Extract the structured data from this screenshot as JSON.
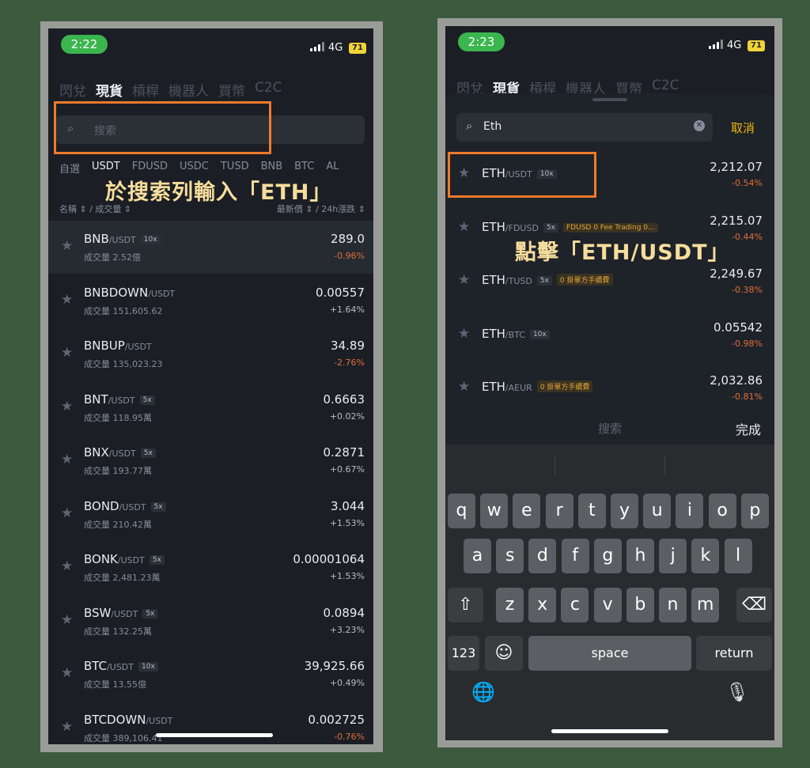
{
  "left": {
    "status": {
      "time": "2:22",
      "network": "4G",
      "battery": "71"
    },
    "top_tabs": [
      "閃兌",
      "現貨",
      "槓桿",
      "機器人",
      "買幣",
      "C2C"
    ],
    "active_tab_index": 1,
    "search_placeholder": "搜索",
    "sub_tabs": [
      "自選",
      "USDT",
      "FDUSD",
      "USDC",
      "TUSD",
      "BNB",
      "BTC",
      "AL"
    ],
    "active_sub_tab_index": 1,
    "annotation": "於搜索列輸入「ETH」",
    "header": {
      "left": "名稱 ⇕ / 成交量 ⇕",
      "right": "最新價 ⇕ / 24h漲跌 ⇕"
    },
    "rows": [
      {
        "base": "BNB",
        "quote": "/USDT",
        "lev": "10x",
        "vol": "成交量 2.52億",
        "price": "289.0",
        "chg": "-0.96%",
        "dir": "neg"
      },
      {
        "base": "BNBDOWN",
        "quote": "/USDT",
        "lev": "",
        "vol": "成交量 151,605.62",
        "price": "0.00557",
        "chg": "+1.64%",
        "dir": "pos"
      },
      {
        "base": "BNBUP",
        "quote": "/USDT",
        "lev": "",
        "vol": "成交量 135,023.23",
        "price": "34.89",
        "chg": "-2.76%",
        "dir": "neg"
      },
      {
        "base": "BNT",
        "quote": "/USDT",
        "lev": "5x",
        "vol": "成交量 118.95萬",
        "price": "0.6663",
        "chg": "+0.02%",
        "dir": "pos"
      },
      {
        "base": "BNX",
        "quote": "/USDT",
        "lev": "5x",
        "vol": "成交量 193.77萬",
        "price": "0.2871",
        "chg": "+0.67%",
        "dir": "pos"
      },
      {
        "base": "BOND",
        "quote": "/USDT",
        "lev": "5x",
        "vol": "成交量 210.42萬",
        "price": "3.044",
        "chg": "+1.53%",
        "dir": "pos"
      },
      {
        "base": "BONK",
        "quote": "/USDT",
        "lev": "5x",
        "vol": "成交量 2,481.23萬",
        "price": "0.00001064",
        "chg": "+1.53%",
        "dir": "pos"
      },
      {
        "base": "BSW",
        "quote": "/USDT",
        "lev": "5x",
        "vol": "成交量 132.25萬",
        "price": "0.0894",
        "chg": "+3.23%",
        "dir": "pos"
      },
      {
        "base": "BTC",
        "quote": "/USDT",
        "lev": "10x",
        "vol": "成交量 13.55億",
        "price": "39,925.66",
        "chg": "+0.49%",
        "dir": "pos"
      },
      {
        "base": "BTCDOWN",
        "quote": "/USDT",
        "lev": "",
        "vol": "成交量 389,106.41",
        "price": "0.002725",
        "chg": "-0.76%",
        "dir": "neg"
      }
    ]
  },
  "right": {
    "status": {
      "time": "2:23",
      "network": "4G",
      "battery": "71"
    },
    "top_tabs": [
      "閃兌",
      "現貨",
      "槓桿",
      "機器人",
      "買幣",
      "C2C"
    ],
    "active_tab_index": 1,
    "search_value": "Eth",
    "cancel_label": "取消",
    "annotation": "點擊「ETH/USDT」",
    "results": [
      {
        "base": "ETH",
        "quote": "/USDT",
        "lev": "10x",
        "tag": "",
        "price": "2,212.07",
        "chg": "-0.54%"
      },
      {
        "base": "ETH",
        "quote": "/FDUSD",
        "lev": "5x",
        "tag": "FDUSD 0 Fee Trading   0...",
        "price": "2,215.07",
        "chg": "-0.44%"
      },
      {
        "base": "ETH",
        "quote": "/TUSD",
        "lev": "5x",
        "tag": "0 掛單方手續費",
        "price": "2,249.67",
        "chg": "-0.38%"
      },
      {
        "base": "ETH",
        "quote": "/BTC",
        "lev": "10x",
        "tag": "",
        "price": "0.05542",
        "chg": "-0.98%"
      },
      {
        "base": "ETH",
        "quote": "/AEUR",
        "lev": "",
        "tag": "0 掛單方手續費",
        "price": "2,032.86",
        "chg": "-0.81%"
      }
    ],
    "kb_toolbar": {
      "search": "搜索",
      "done": "完成"
    },
    "keyboard": {
      "row1": [
        "q",
        "w",
        "e",
        "r",
        "t",
        "y",
        "u",
        "i",
        "o",
        "p"
      ],
      "row2": [
        "a",
        "s",
        "d",
        "f",
        "g",
        "h",
        "j",
        "k",
        "l"
      ],
      "row3": [
        "z",
        "x",
        "c",
        "v",
        "b",
        "n",
        "m"
      ],
      "shift_icon": "⇧",
      "delete_icon": "⌫",
      "numbers_label": "123",
      "emoji_icon": "☺",
      "space_label": "space",
      "return_label": "return",
      "globe_icon": "🌐",
      "mic_icon": "🎙"
    }
  }
}
